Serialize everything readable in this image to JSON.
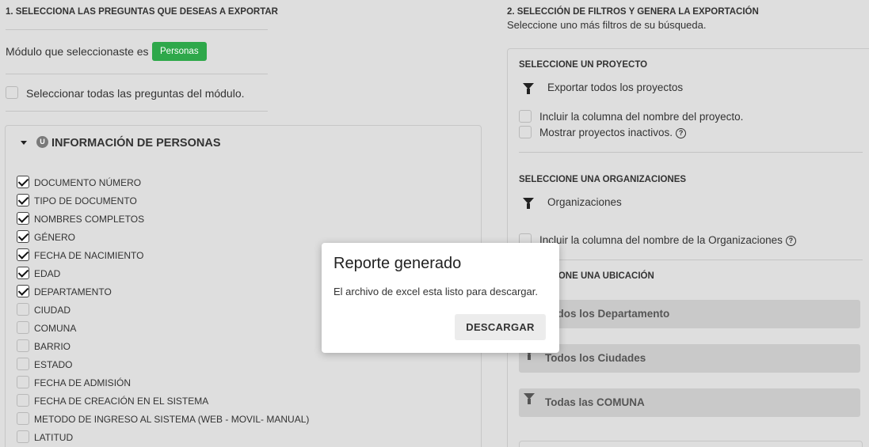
{
  "left": {
    "section_title": "1. SELECCIONA LAS PREGUNTAS QUE DESEAS A EXPORTAR",
    "module_label": "Módulo que seleccionaste es :",
    "module_badge": "Personas",
    "select_all_label": "Seleccionar todas las preguntas del módulo.",
    "group": {
      "badge": "U",
      "title": "INFORMACIÓN DE PERSONAS",
      "questions": [
        {
          "label": "DOCUMENTO NÚMERO",
          "checked": true
        },
        {
          "label": "TIPO DE DOCUMENTO",
          "checked": true
        },
        {
          "label": "NOMBRES COMPLETOS",
          "checked": true
        },
        {
          "label": "GÉNERO",
          "checked": true
        },
        {
          "label": "FECHA DE NACIMIENTO",
          "checked": true
        },
        {
          "label": "EDAD",
          "checked": true
        },
        {
          "label": "DEPARTAMENTO",
          "checked": true
        },
        {
          "label": "CIUDAD",
          "checked": false
        },
        {
          "label": "COMUNA",
          "checked": false
        },
        {
          "label": "BARRIO",
          "checked": false
        },
        {
          "label": "ESTADO",
          "checked": false
        },
        {
          "label": "FECHA DE ADMISIÓN",
          "checked": false
        },
        {
          "label": "FECHA DE CREACIÓN EN EL SISTEMA",
          "checked": false
        },
        {
          "label": "METODO DE INGRESO AL SISTEMA (WEB - MOVIL- MANUAL)",
          "checked": false
        },
        {
          "label": "LATITUD",
          "checked": false
        }
      ]
    }
  },
  "right": {
    "section_title": "2. SELECCIÓN DE FILTROS Y GENERA LA EXPORTACIÓN",
    "section_subtitle": "Seleccione uno más filtros de su búsqueda.",
    "project": {
      "title": "SELECCIONE UN PROYECTO",
      "filter_label": "Exportar todos los proyectos",
      "include_label": "Incluir la columna del nombre del proyecto.",
      "inactive_label": "Mostrar proyectos inactivos.",
      "help": "?"
    },
    "org": {
      "title": "SELECCIONE UNA ORGANIZACIONES",
      "filter_label": "Organizaciones",
      "include_label": "Incluir la columna del nombre de la Organizaciones",
      "help": "?"
    },
    "location": {
      "title": "SELECCIONE UNA UBICACIÓN",
      "department": "Todos los Departamento",
      "city": "Todos los Ciudades",
      "comuna": "Todas las COMUNA"
    }
  },
  "dialog": {
    "title": "Reporte generado",
    "message": "El archivo de excel esta listo para descargar.",
    "button": "DESCARGAR"
  }
}
